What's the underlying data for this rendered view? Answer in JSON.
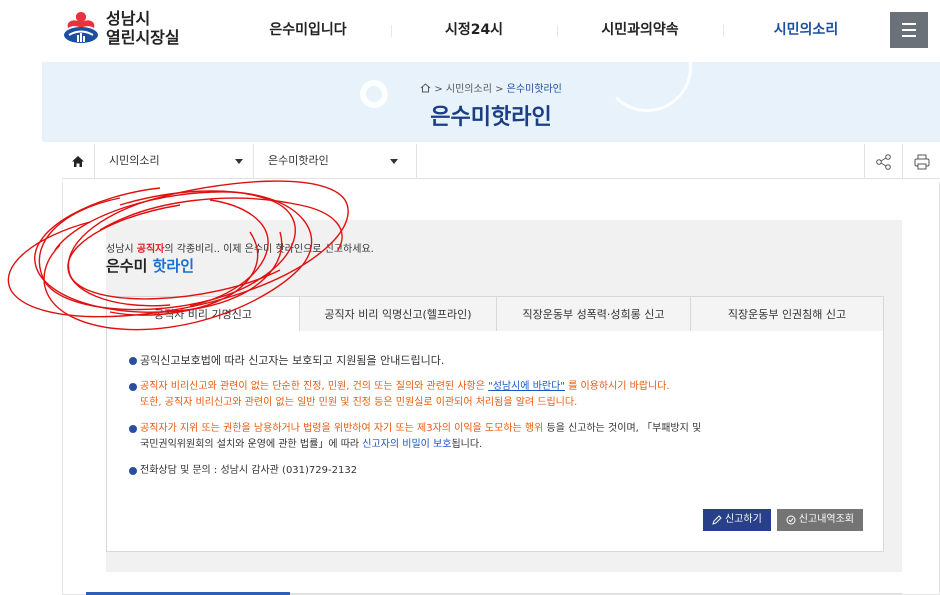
{
  "header": {
    "logo": {
      "line1": "성남시",
      "line2": "열린시장실"
    },
    "nav": [
      "은수미입니다",
      "시정24시",
      "시민과의약속",
      "시민의소리"
    ],
    "active_nav_index": 3,
    "menu_icon": "hamburger-icon"
  },
  "banner": {
    "breadcrumb": {
      "parent": "시민의소리",
      "separator": ">",
      "current": "은수미핫라인"
    },
    "title": "은수미핫라인"
  },
  "location_bar": {
    "select1": "시민의소리",
    "select2": "은수미핫라인",
    "icons": [
      "home-icon",
      "share-icon",
      "print-icon"
    ]
  },
  "intro": {
    "line_prefix": "성남시 ",
    "line_highlight": "공직자",
    "line_suffix": "의 각종비리.. 이제 은수미 핫라인으로 신고하세요.",
    "hotline_part1": "은수미 ",
    "hotline_part2": "핫라인"
  },
  "tabs": [
    {
      "label": "공직자 비리 기명신고",
      "active": true
    },
    {
      "label": "공직자 비리 익명신고(헬프라인)",
      "active": false
    },
    {
      "label": "직장운동부 성폭력·성희롱 신고",
      "active": false
    },
    {
      "label": "직장운동부 인권침해 신고",
      "active": false
    }
  ],
  "info": {
    "b1": "공익신고보호법에 따라 신고자는 보호되고 지원됨을 안내드립니다.",
    "b2_pre": "공직자 비리신고와 관련이 없는 단순한 진정, 민원, 건의 또는 질의와 관련된 사항은 ",
    "b2_link": "\"성남시에 바란다\"",
    "b2_post": " 를 이용하시기 바랍니다.",
    "b2_line2": "또한, 공직자 비리신고와 관련이 없는 일반 민원 및 진정 등은 민원실로 이관되어 처리됨을 알려 드립니다.",
    "b3_orange": "공직자가 지위 또는 권한을 남용하거나 법령을 위반하여 자기 또는 제3자의 이익을 도모하는 행위",
    "b3_rest": " 등을 신고하는 것이며, 「부패방지 및",
    "b3_line2_pre": "국민권익위원회의 설치와 운영에 관한 법률」에 따라 ",
    "b3_line2_blue": "신고자의 비밀이 보호",
    "b3_line2_post": "됩니다.",
    "b4": "전화상담 및 문의 : 성남시 감사관 (031)729-2132"
  },
  "buttons": {
    "report": "신고하기",
    "history": "신고내역조회"
  },
  "colors": {
    "accent_blue": "#1a3f86",
    "nav_active": "#1a4fa0",
    "highlight_red": "#dd2222",
    "orange_text": "#e85a10",
    "banner_bg": "#e7f2fb",
    "button_primary": "#28408a",
    "annotation_red": "#e01010"
  }
}
